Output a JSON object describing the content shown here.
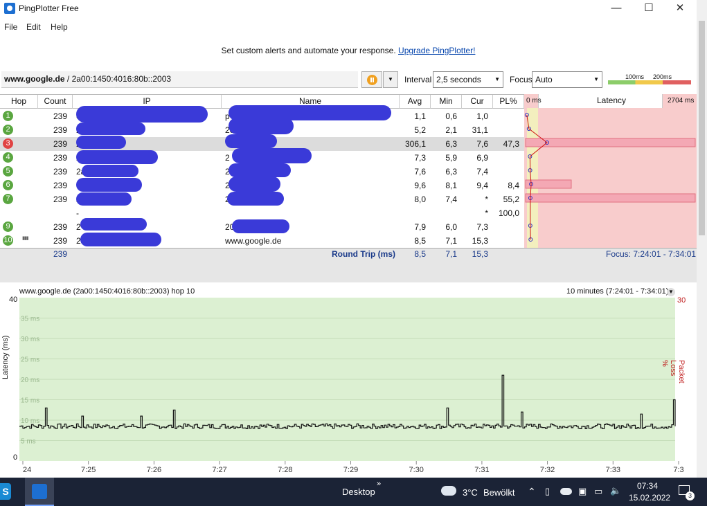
{
  "window": {
    "title": "PingPlotter Free",
    "minimize": "—",
    "maximize": "☐",
    "close": "✕"
  },
  "menu": [
    "File",
    "Edit",
    "Help"
  ],
  "banner": {
    "text": "Set custom alerts and automate your response.",
    "link": "Upgrade PingPlotter!"
  },
  "toolbar": {
    "target_bold": "www.google.de",
    "target_rest": " / 2a00:1450:4016:80b::2003",
    "interval_label": "Interval",
    "interval_value": "2,5 seconds",
    "focus_label": "Focus",
    "focus_value": "Auto",
    "scale_100": "100ms",
    "scale_200": "200ms"
  },
  "table": {
    "columns": [
      "Hop",
      "Count",
      "IP",
      "Name",
      "Avg",
      "Min",
      "Cur",
      "PL%"
    ],
    "latency_header": "Latency",
    "latency_min": "0 ms",
    "latency_max": "2704 ms",
    "rows": [
      {
        "hop": "1",
        "count": "239",
        "ip": "0",
        "name": "p",
        "avg": "1,1",
        "min": "0,6",
        "cur": "1,0",
        "pl": "",
        "state": "green"
      },
      {
        "hop": "2",
        "count": "239",
        "ip": "2",
        "name": "20",
        "avg": "5,2",
        "min": "2,1",
        "cur": "31,1",
        "pl": "",
        "state": "green"
      },
      {
        "hop": "3",
        "count": "239",
        "ip": "2",
        "name": "",
        "avg": "306,1",
        "min": "6,3",
        "cur": "7,6",
        "pl": "47,3",
        "state": "red"
      },
      {
        "hop": "4",
        "count": "239",
        "ip": "2",
        "name": "2",
        "avg": "7,3",
        "min": "5,9",
        "cur": "6,9",
        "pl": "",
        "state": "green"
      },
      {
        "hop": "5",
        "count": "239",
        "ip": "2a",
        "name": "2",
        "avg": "7,6",
        "min": "6,3",
        "cur": "7,4",
        "pl": "",
        "state": "green"
      },
      {
        "hop": "6",
        "count": "239",
        "ip": "6",
        "name": "2",
        "avg": "9,6",
        "min": "8,1",
        "cur": "9,4",
        "pl": "8,4",
        "state": "green"
      },
      {
        "hop": "7",
        "count": "239",
        "ip": "2",
        "name": "2",
        "avg": "8,0",
        "min": "7,4",
        "cur": "*",
        "pl": "55,2",
        "state": "green"
      },
      {
        "hop": "",
        "count": "",
        "ip": "-",
        "name": "",
        "avg": "",
        "min": "",
        "cur": "*",
        "pl": "100,0",
        "state": "none"
      },
      {
        "hop": "9",
        "count": "239",
        "ip": "2",
        "name": "20",
        "avg": "7,9",
        "min": "6,0",
        "cur": "7,3",
        "pl": "",
        "state": "green"
      },
      {
        "hop": "10",
        "count": "239",
        "ip": "2a",
        "name": "www.google.de",
        "avg": "8,5",
        "min": "7,1",
        "cur": "15,3",
        "pl": "",
        "state": "green"
      }
    ],
    "summary": {
      "count": "239",
      "label": "Round Trip (ms)",
      "avg": "8,5",
      "min": "7,1",
      "cur": "15,3",
      "focus": "Focus: 7:24:01 - 7:34:01"
    }
  },
  "graph": {
    "title": "www.google.de (2a00:1450:4016:80b::2003) hop 10",
    "range": "10 minutes (7:24:01 - 7:34:01)",
    "ylabel": "Latency (ms)",
    "ylabel_right": "Packet Loss %",
    "y_top": "40",
    "y_bottom": "0",
    "y_right_top": "30",
    "gridlines": [
      "35 ms",
      "30 ms",
      "25 ms",
      "20 ms",
      "15 ms",
      "10 ms",
      "5 ms"
    ],
    "x_ticks": [
      "24",
      "7:25",
      "7:26",
      "7:27",
      "7:28",
      "7:29",
      "7:30",
      "7:31",
      "7:32",
      "7:33",
      "7:3"
    ],
    "spikes": [
      {
        "pos": 0.04,
        "ms": 13
      },
      {
        "pos": 0.095,
        "ms": 11
      },
      {
        "pos": 0.186,
        "ms": 11
      },
      {
        "pos": 0.236,
        "ms": 12.5
      },
      {
        "pos": 0.651,
        "ms": 13
      },
      {
        "pos": 0.735,
        "ms": 21
      },
      {
        "pos": 0.766,
        "ms": 12
      },
      {
        "pos": 0.947,
        "ms": 11.5
      },
      {
        "pos": 0.998,
        "ms": 15
      }
    ],
    "base_ms": 8.5,
    "colors": {
      "bg": "#dcf0d2",
      "line": "#111111",
      "grid": "#c4dcb8"
    }
  },
  "taskbar": {
    "desktop": "Desktop",
    "weather_temp": "3°C",
    "weather_text": "Bewölkt",
    "time": "07:34",
    "date": "15.02.2022",
    "notifications": "3"
  }
}
